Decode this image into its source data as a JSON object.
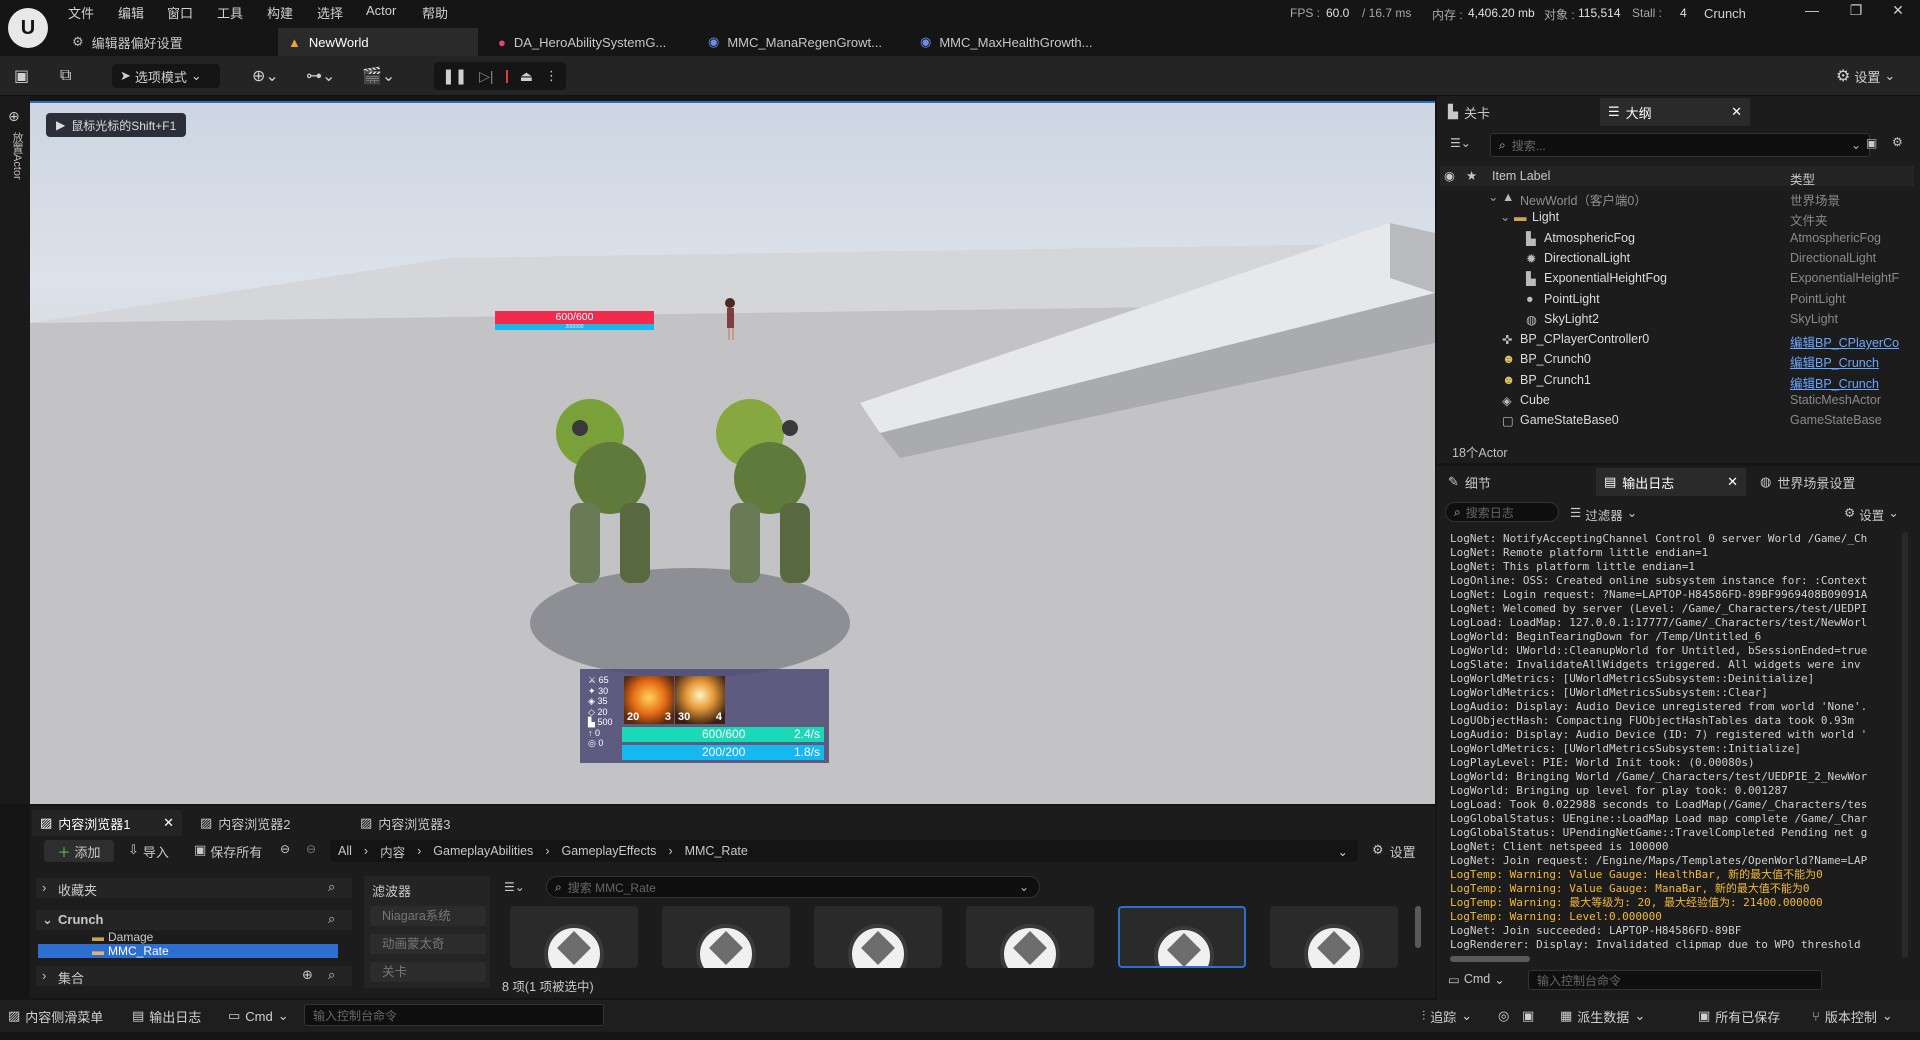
{
  "menu": [
    "文件",
    "编辑",
    "窗口",
    "工具",
    "构建",
    "选择",
    "Actor",
    "帮助"
  ],
  "doc_tabs": [
    {
      "label": "编辑器偏好设置"
    },
    {
      "label": "NewWorld"
    },
    {
      "label": "DA_HeroAbilitySystemG..."
    },
    {
      "label": "MMC_ManaRegenGrowt..."
    },
    {
      "label": "MMC_MaxHealthGrowth..."
    }
  ],
  "stats": {
    "fps_label": "FPS :",
    "fps": "60.0",
    "ms": "/ 16.7 ms",
    "mem_label": "内存 :",
    "mem": "4,406.20 mb",
    "obj_label": "对象 :",
    "obj": "115,514",
    "stall_label": "Stall :",
    "stall": "4",
    "project": "Crunch"
  },
  "toolbar": {
    "mode": "选项模式",
    "settings": "设置"
  },
  "viewport": {
    "hint": "鼠标光标的Shift+F1",
    "side_label": "放置Actor",
    "enemy_health": "600/600",
    "enemy_mana": "200/200",
    "hud": {
      "stats": [
        "65",
        "30",
        "35",
        "20",
        "500",
        "0",
        "0"
      ],
      "ability1_level": "20",
      "ability1_cost": "3",
      "ability2_level": "30",
      "ability2_cost": "4",
      "health": "600/600",
      "health_regen": "2.4/s",
      "mana": "200/200",
      "mana_regen": "1.8/s"
    }
  },
  "outliner": {
    "tab_level": "关卡",
    "tab_outline": "大纲",
    "search_placeholder": "搜索...",
    "col_label": "Item Label",
    "col_type": "类型",
    "rows": [
      {
        "label": "NewWorld（客户端0）",
        "type": "世界场景",
        "link": false
      },
      {
        "label": "Light",
        "type": "文件夹",
        "link": false
      },
      {
        "label": "AtmosphericFog",
        "type": "AtmosphericFog",
        "link": false
      },
      {
        "label": "DirectionalLight",
        "type": "DirectionalLight",
        "link": false
      },
      {
        "label": "ExponentialHeightFog",
        "type": "ExponentialHeightF",
        "link": false
      },
      {
        "label": "PointLight",
        "type": "PointLight",
        "link": false
      },
      {
        "label": "SkyLight2",
        "type": "SkyLight",
        "link": false
      },
      {
        "label": "BP_CPlayerController0",
        "type": "编辑BP_CPlayerCo",
        "link": true
      },
      {
        "label": "BP_Crunch0",
        "type": "编辑BP_Crunch",
        "link": true
      },
      {
        "label": "BP_Crunch1",
        "type": "编辑BP_Crunch",
        "link": true
      },
      {
        "label": "Cube",
        "type": "StaticMeshActor",
        "link": false
      },
      {
        "label": "GameStateBase0",
        "type": "GameStateBase",
        "link": false
      }
    ],
    "count": "18个Actor"
  },
  "log_panel": {
    "tab_details": "细节",
    "tab_log": "输出日志",
    "tab_world": "世界场景设置",
    "search_placeholder": "搜索日志",
    "filter": "过滤器",
    "settings": "设置",
    "cmd": "Cmd",
    "cmd_placeholder": "输入控制台命令",
    "lines": [
      {
        "t": "LogNet: NotifyAcceptingChannel Control 0 server World /Game/_Ch",
        "w": false
      },
      {
        "t": "LogNet: Remote platform little endian=1",
        "w": false
      },
      {
        "t": "LogNet: This platform little endian=1",
        "w": false
      },
      {
        "t": "LogOnline: OSS: Created online subsystem instance for: :Context",
        "w": false
      },
      {
        "t": "LogNet: Login request: ?Name=LAPTOP-H84586FD-89BF9969408B09091A",
        "w": false
      },
      {
        "t": "LogNet: Welcomed by server (Level: /Game/_Characters/test/UEDPI",
        "w": false
      },
      {
        "t": "LogLoad: LoadMap: 127.0.0.1:17777/Game/_Characters/test/NewWorl",
        "w": false
      },
      {
        "t": "LogWorld: BeginTearingDown for /Temp/Untitled_6",
        "w": false
      },
      {
        "t": "LogWorld: UWorld::CleanupWorld for Untitled, bSessionEnded=true",
        "w": false
      },
      {
        "t": "LogSlate: InvalidateAllWidgets triggered.  All widgets were inv",
        "w": false
      },
      {
        "t": "LogWorldMetrics: [UWorldMetricsSubsystem::Deinitialize]",
        "w": false
      },
      {
        "t": "LogWorldMetrics: [UWorldMetricsSubsystem::Clear]",
        "w": false
      },
      {
        "t": "LogAudio: Display: Audio Device unregistered from world 'None'.",
        "w": false
      },
      {
        "t": "LogUObjectHash: Compacting FUObjectHashTables data took   0.93m",
        "w": false
      },
      {
        "t": "LogAudio: Display: Audio Device (ID: 7) registered with world '",
        "w": false
      },
      {
        "t": "LogWorldMetrics: [UWorldMetricsSubsystem::Initialize]",
        "w": false
      },
      {
        "t": "LogPlayLevel: PIE: World Init took: (0.00080s)",
        "w": false
      },
      {
        "t": "LogWorld: Bringing World /Game/_Characters/test/UEDPIE_2_NewWor",
        "w": false
      },
      {
        "t": "LogWorld: Bringing up level for play took: 0.001287",
        "w": false
      },
      {
        "t": "LogLoad: Took 0.022988 seconds to LoadMap(/Game/_Characters/tes",
        "w": false
      },
      {
        "t": "LogGlobalStatus: UEngine::LoadMap Load map complete /Game/_Char",
        "w": false
      },
      {
        "t": "LogGlobalStatus: UPendingNetGame::TravelCompleted Pending net g",
        "w": false
      },
      {
        "t": "LogNet: Client netspeed is 100000",
        "w": false
      },
      {
        "t": "LogNet: Join request: /Engine/Maps/Templates/OpenWorld?Name=LAP",
        "w": false
      },
      {
        "t": "LogTemp: Warning: Value Gauge: HealthBar, 新的最大值不能为0",
        "w": true
      },
      {
        "t": "LogTemp: Warning: Value Gauge: ManaBar, 新的最大值不能为0",
        "w": true
      },
      {
        "t": "LogTemp: Warning: 最大等级为: 20, 最大经验值为: 21400.000000",
        "w": true
      },
      {
        "t": "LogTemp: Warning: Level:0.000000",
        "w": true
      },
      {
        "t": "LogNet: Join succeeded: LAPTOP-H84586FD-89BF",
        "w": false
      },
      {
        "t": "LogRenderer: Display: Invalidated clipmap due to WPO threshold",
        "w": false
      }
    ]
  },
  "content_browser": {
    "tabs": [
      "内容浏览器1",
      "内容浏览器2",
      "内容浏览器3"
    ],
    "add": "添加",
    "import": "导入",
    "save_all": "保存所有",
    "breadcrumb": [
      "All",
      "内容",
      "GameplayAbilities",
      "GameplayEffects",
      "MMC_Rate"
    ],
    "settings": "设置",
    "favorites": "收藏夹",
    "root": "Crunch",
    "folders": [
      "Damage",
      "MMC_Rate"
    ],
    "collections": "集合",
    "filters_title": "滤波器",
    "filters": [
      "Niagara系统",
      "动画蒙太奇",
      "关卡"
    ],
    "search_placeholder": "搜索 MMC_Rate",
    "summary": "8 项(1 项被选中)"
  },
  "statusbar": {
    "drawer": "内容侧滑菜单",
    "log": "输出日志",
    "cmd": "Cmd",
    "cmd_placeholder": "输入控制台命令",
    "trace": "追踪",
    "derived": "派生数据",
    "saved": "所有已保存",
    "vcs": "版本控制"
  },
  "colors": {
    "accent": "#2d6fd1",
    "health": "#1ad9b8",
    "mana": "#16b8f0",
    "enemy_health": "#f02b4d",
    "warning": "#f3b93c"
  }
}
